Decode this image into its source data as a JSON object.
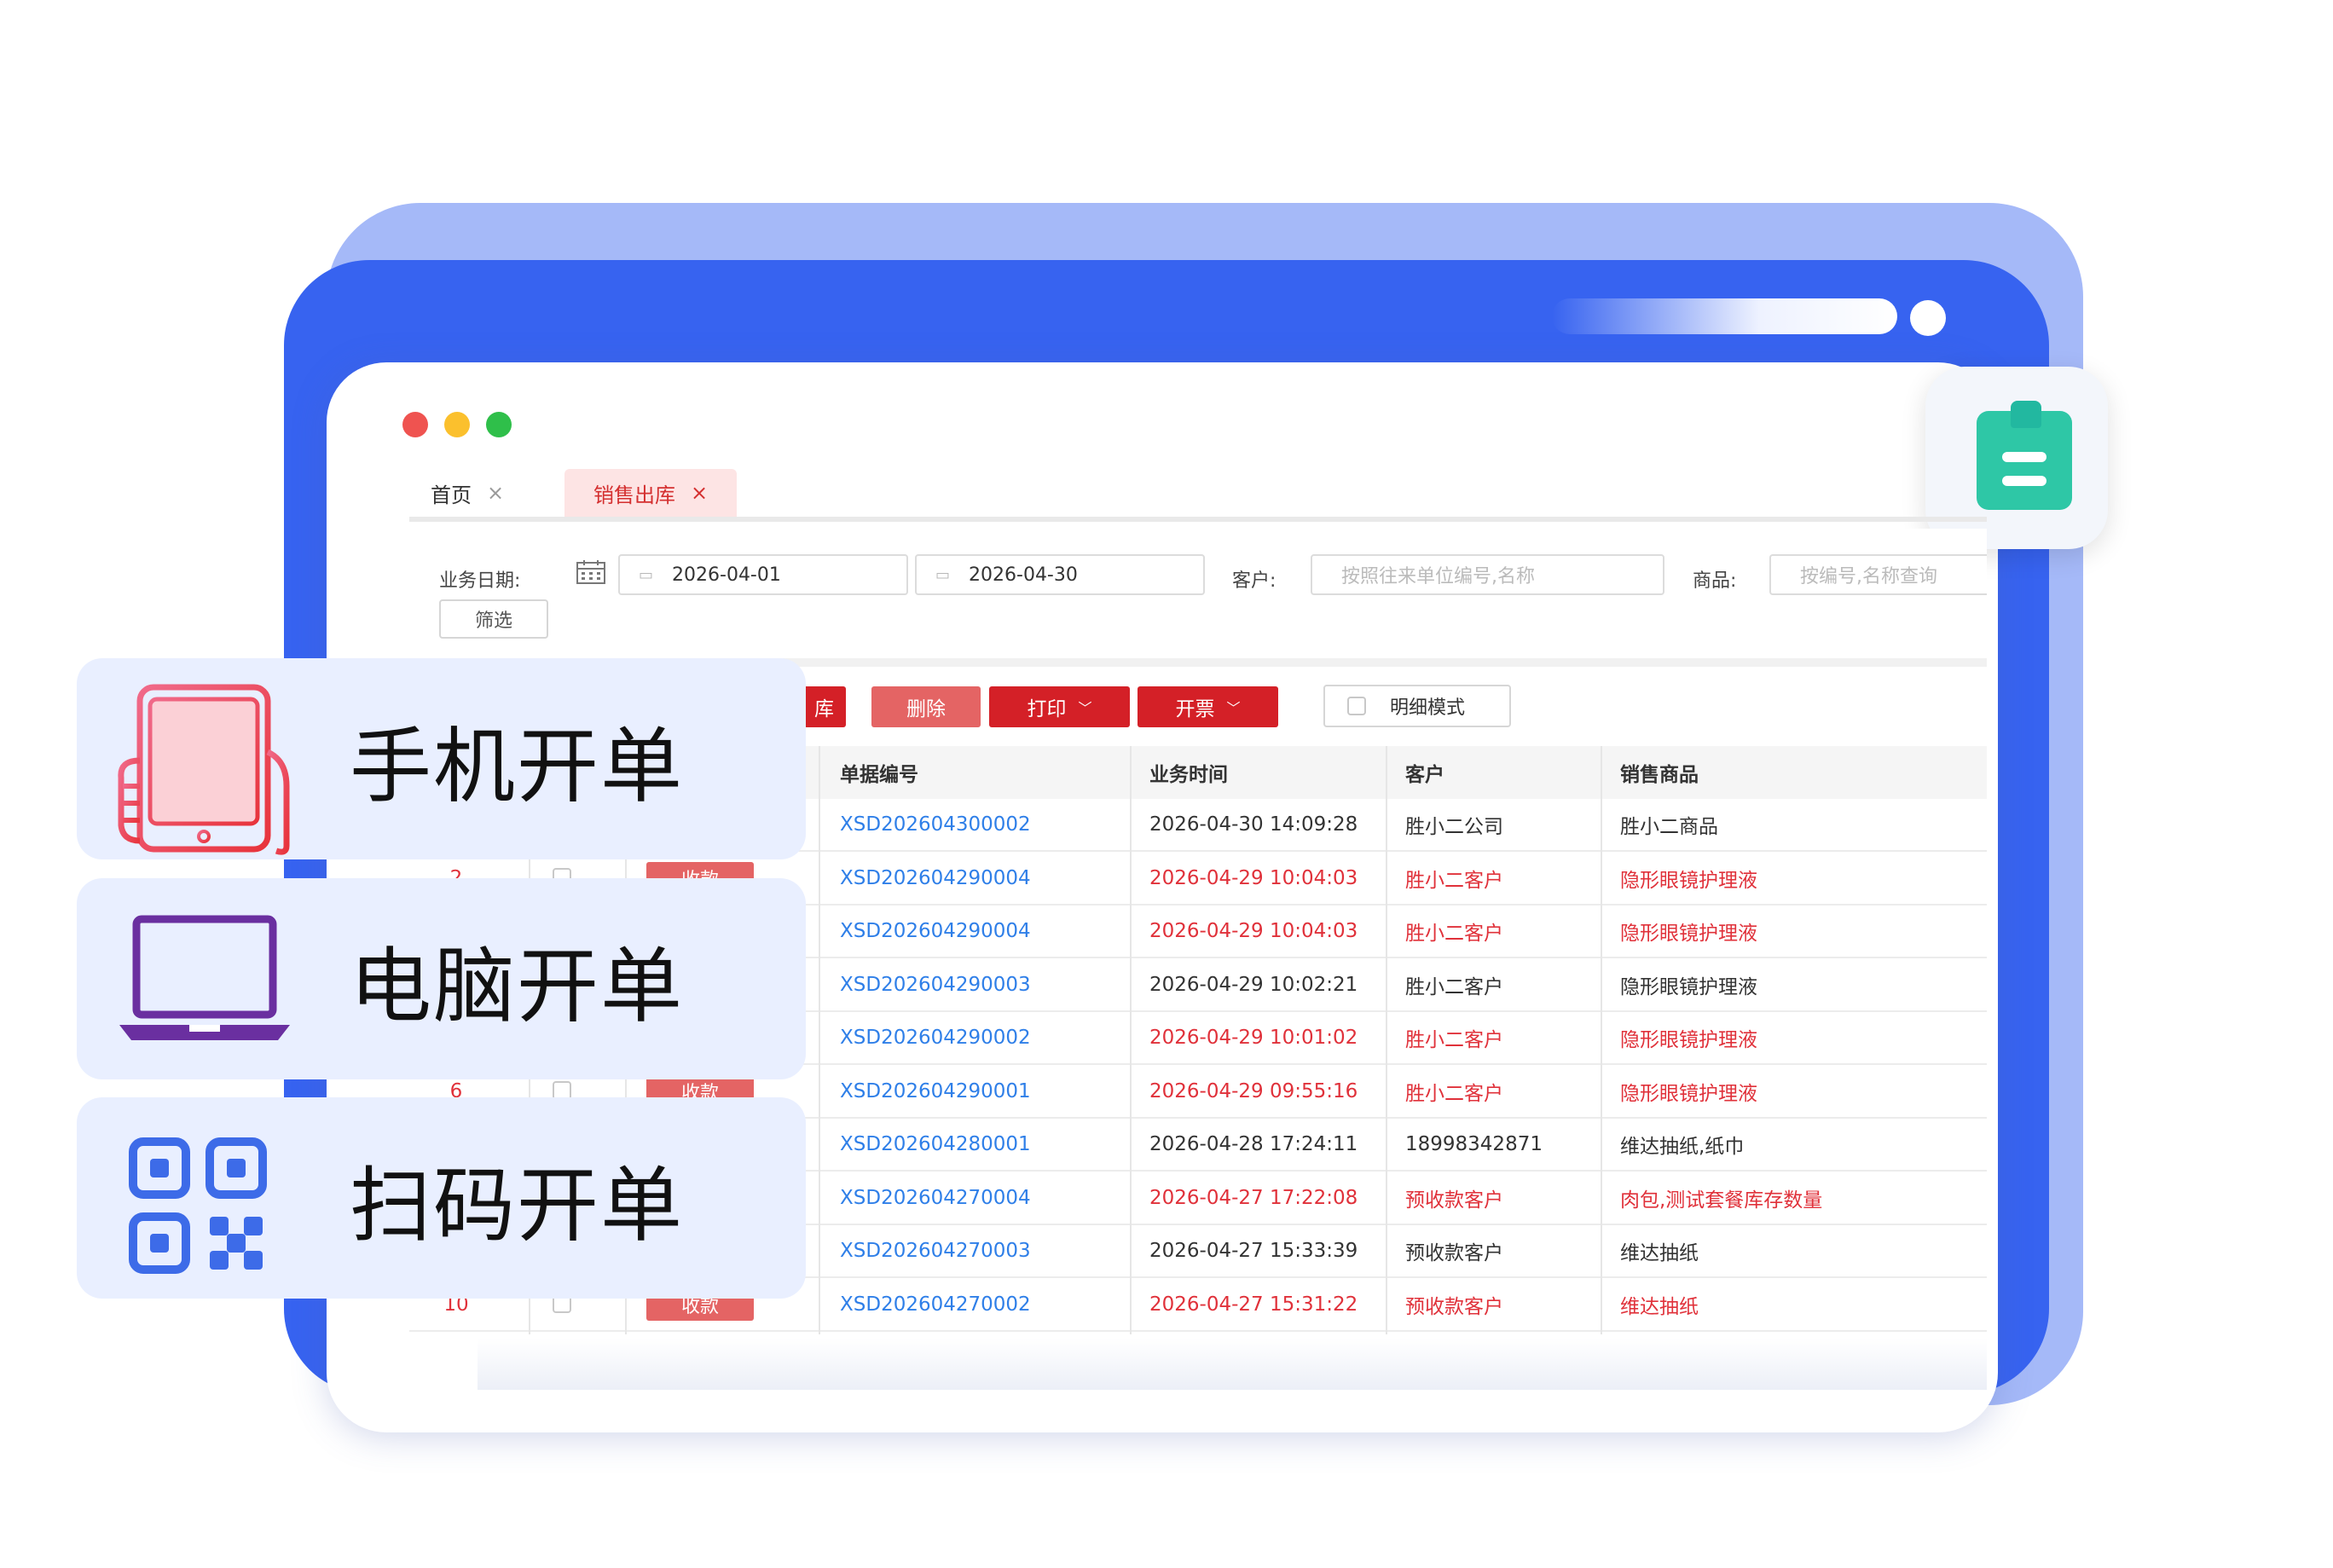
{
  "tabs": [
    {
      "label": "首页",
      "close": "×"
    },
    {
      "label": "销售出库",
      "close": "×"
    }
  ],
  "filters": {
    "date_label": "业务日期:",
    "date_start": "2026-04-01",
    "date_end": "2026-04-30",
    "customer_label": "客户:",
    "customer_placeholder": "按照往来单位编号,名称",
    "product_label": "商品:",
    "product_placeholder": "按编号,名称查询",
    "filter_button": "筛选"
  },
  "toolbar": {
    "delete": "删除",
    "print": "打印",
    "invoice": "开票",
    "detail_mode": "明细模式",
    "hidden_button_tail": "库"
  },
  "table": {
    "columns": {
      "no": "单据编号",
      "time": "业务时间",
      "customer": "客户",
      "product": "销售商品"
    },
    "rows": [
      {
        "idx": "",
        "action": "",
        "no": "XSD202604300002",
        "time": "2026-04-30 14:09:28",
        "customer": "胜小二公司",
        "product": "胜小二商品",
        "highlight": false
      },
      {
        "idx": "2",
        "action": "收款",
        "no": "XSD202604290004",
        "time": "2026-04-29 10:04:03",
        "customer": "胜小二客户",
        "product": "隐形眼镜护理液",
        "highlight": true
      },
      {
        "idx": "",
        "action": "",
        "no": "XSD202604290004",
        "time": "2026-04-29 10:04:03",
        "customer": "胜小二客户",
        "product": "隐形眼镜护理液",
        "highlight": true
      },
      {
        "idx": "",
        "action": "",
        "no": "XSD202604290003",
        "time": "2026-04-29 10:02:21",
        "customer": "胜小二客户",
        "product": "隐形眼镜护理液",
        "highlight": false
      },
      {
        "idx": "",
        "action": "",
        "no": "XSD202604290002",
        "time": "2026-04-29 10:01:02",
        "customer": "胜小二客户",
        "product": "隐形眼镜护理液",
        "highlight": true
      },
      {
        "idx": "6",
        "action": "收款",
        "no": "XSD202604290001",
        "time": "2026-04-29 09:55:16",
        "customer": "胜小二客户",
        "product": "隐形眼镜护理液",
        "highlight": true
      },
      {
        "idx": "",
        "action": "",
        "no": "XSD202604280001",
        "time": "2026-04-28 17:24:11",
        "customer": "18998342871",
        "product": "维达抽纸,纸巾",
        "highlight": false
      },
      {
        "idx": "",
        "action": "",
        "no": "XSD202604270004",
        "time": "2026-04-27 17:22:08",
        "customer": "预收款客户",
        "product": "肉包,测试套餐库存数量",
        "highlight": true
      },
      {
        "idx": "",
        "action": "",
        "no": "XSD202604270003",
        "time": "2026-04-27 15:33:39",
        "customer": "预收款客户",
        "product": "维达抽纸",
        "highlight": false
      },
      {
        "idx": "10",
        "action": "收款",
        "no": "XSD202604270002",
        "time": "2026-04-27 15:31:22",
        "customer": "预收款客户",
        "product": "维达抽纸",
        "highlight": true
      }
    ]
  },
  "features": [
    {
      "label": "手机开单",
      "icon": "tablet-hand-icon",
      "color": "#e8384f"
    },
    {
      "label": "电脑开单",
      "icon": "laptop-icon",
      "color": "#6a2fa0"
    },
    {
      "label": "扫码开单",
      "icon": "qr-code-icon",
      "color": "#3d6be8"
    }
  ],
  "colors": {
    "primary_blue": "#3763f0",
    "brand_red": "#d42027",
    "link_blue": "#2f7fe8",
    "alert_red": "#e0313a",
    "clip_green": "#2ec7a6"
  }
}
